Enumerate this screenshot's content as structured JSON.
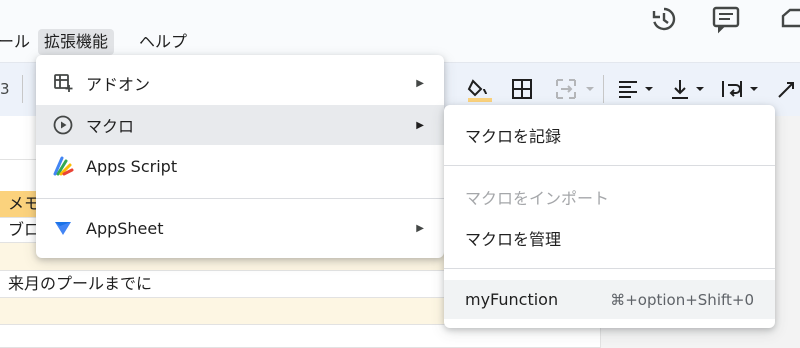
{
  "menubar": {
    "tools_label": "ール",
    "extensions_label": "拡張機能",
    "help_label": "ヘルプ"
  },
  "toolbar": {
    "partial_value": "3"
  },
  "sheet": {
    "cells": {
      "memo_header": "メモ",
      "row2": "ブロ",
      "row4": "来月のプールまでに"
    },
    "colors": {
      "header_fill": "#fbd27d",
      "alt_row_fill": "#fdf6e3"
    }
  },
  "extensions_menu": {
    "items": [
      {
        "label": "アドオン",
        "icon": "addon-icon",
        "has_submenu": true
      },
      {
        "label": "マクロ",
        "icon": "play-circle-icon",
        "has_submenu": true
      },
      {
        "label": "Apps Script",
        "icon": "apps-script-icon",
        "has_submenu": false
      },
      {
        "label": "AppSheet",
        "icon": "appsheet-icon",
        "has_submenu": true
      }
    ],
    "submenu_arrow": "▶"
  },
  "macros_submenu": {
    "record": "マクロを記録",
    "import": "マクロをインポート",
    "manage": "マクロを管理",
    "function_name": "myFunction",
    "function_shortcut": "⌘+option+Shift+0"
  }
}
